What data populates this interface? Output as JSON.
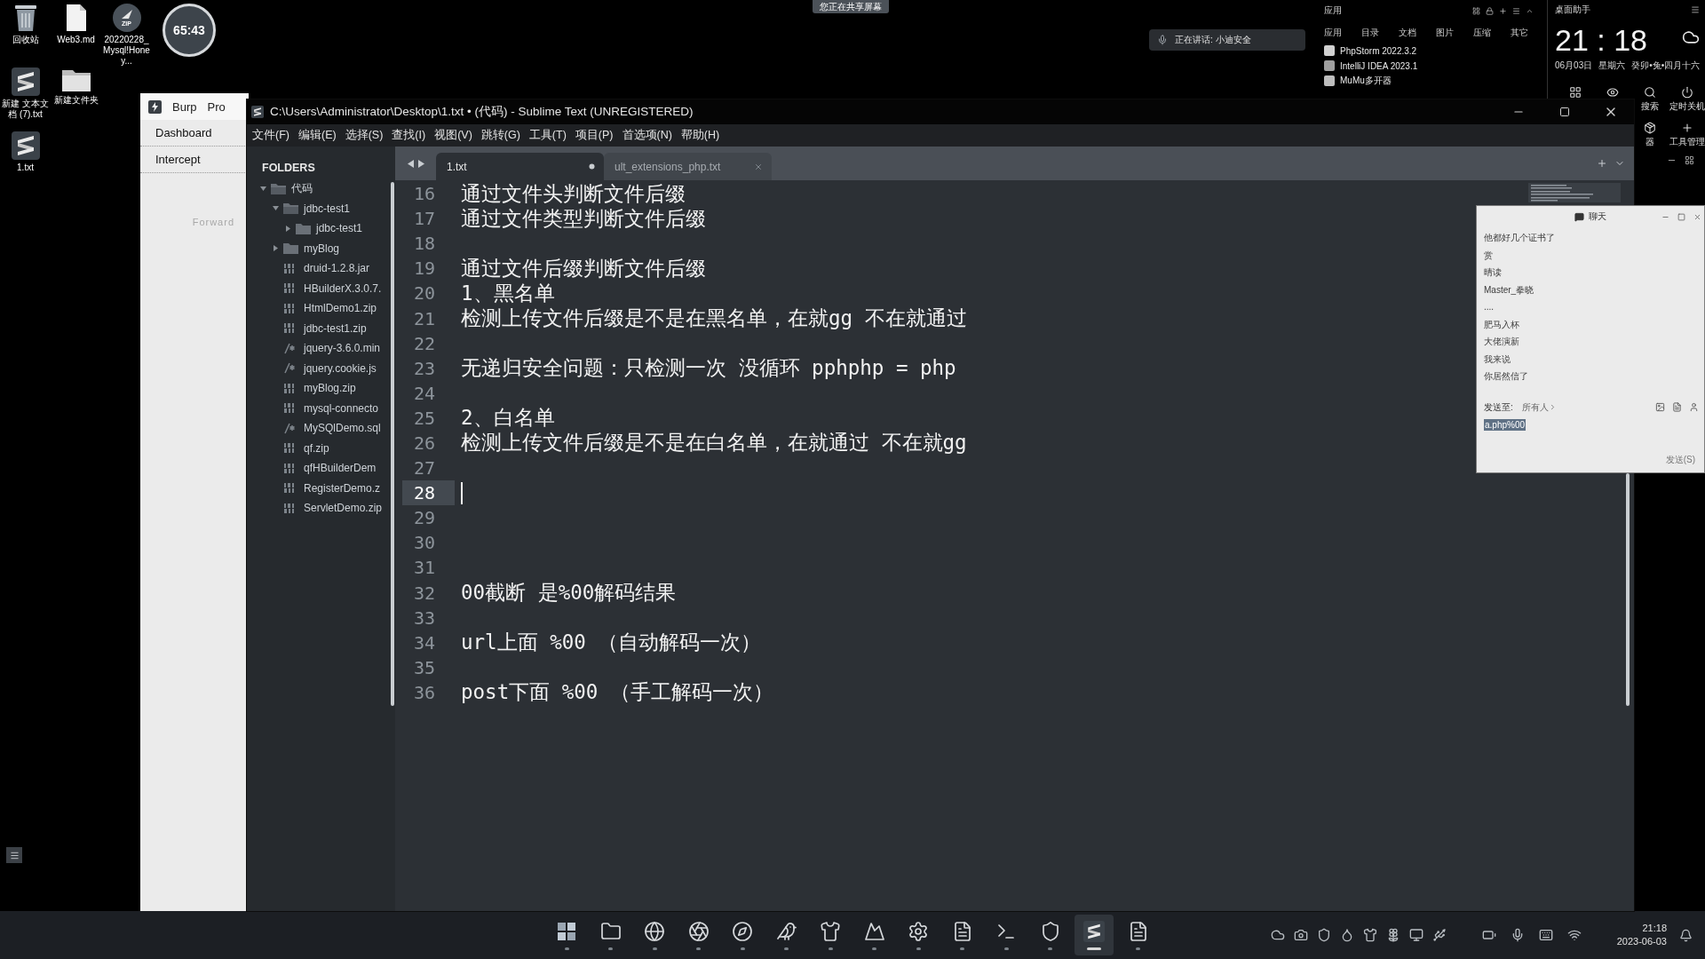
{
  "desktop": {
    "icons": [
      {
        "label": "回收站",
        "kind": "bin"
      },
      {
        "label": "Web3.md",
        "kind": "file"
      },
      {
        "label": "20220228_Mysql!Honey...",
        "kind": "zip",
        "badge": "ZIP"
      },
      {
        "label": "新建 文本文档 (7).txt",
        "kind": "sublime"
      },
      {
        "label": "新建文件夹",
        "kind": "folder"
      },
      {
        "label": "1.txt",
        "kind": "sublime"
      }
    ],
    "timer": "65:43"
  },
  "share_banner": "您正在共享屏幕",
  "voice_pill": {
    "label": "正在讲话: 小迪安全"
  },
  "apps_panel": {
    "title": "应用",
    "tabs": [
      "应用",
      "目录",
      "文档",
      "图片",
      "压缩",
      "其它"
    ],
    "items": [
      {
        "label": "PhpStorm 2022.3.2",
        "kind": "ps"
      },
      {
        "label": "IntelliJ IDEA 2023.1",
        "kind": "ij"
      },
      {
        "label": "MuMu多开器",
        "kind": "mumu"
      }
    ]
  },
  "assistant": {
    "title": "桌面助手",
    "time": "21 : 18",
    "date": "06月03日",
    "weekday": "星期六",
    "lunar": "癸卯•兔•四月十六",
    "tools_top": [
      {
        "kind": "grid"
      },
      {
        "kind": "eye"
      },
      {
        "kind": "search",
        "label": "搜索"
      },
      {
        "kind": "power",
        "label": "定时关机"
      }
    ],
    "tools_bottom": [
      {
        "kind": "box",
        "label": "器"
      },
      {
        "kind": "plus",
        "label": "工具管理"
      }
    ]
  },
  "burp": {
    "tabs": [
      "Burp",
      "Pro"
    ],
    "nav": [
      "Dashboard",
      "Intercept"
    ],
    "forward": {
      "label": "Forward",
      "disabled": true
    }
  },
  "sublime": {
    "title": "C:\\Users\\Administrator\\Desktop\\1.txt • (代码) - Sublime Text (UNREGISTERED)",
    "menu": [
      "文件(F)",
      "编辑(E)",
      "选择(S)",
      "查找(I)",
      "视图(V)",
      "跳转(G)",
      "工具(T)",
      "项目(P)",
      "首选项(N)",
      "帮助(H)"
    ],
    "sidebar": {
      "heading": "FOLDERS",
      "tree": [
        {
          "label": "代码",
          "kind": "folder",
          "expanded": true,
          "children": [
            {
              "label": "jdbc-test1",
              "kind": "folder",
              "expanded": true,
              "children": [
                {
                  "label": "jdbc-test1",
                  "kind": "folder",
                  "expanded": false
                }
              ]
            },
            {
              "label": "myBlog",
              "kind": "folder",
              "expanded": false
            },
            {
              "label": "druid-1.2.8.jar",
              "kind": "binary"
            },
            {
              "label": "HBuilderX.3.0.7.",
              "kind": "binary"
            },
            {
              "label": "HtmlDemo1.zip",
              "kind": "binary"
            },
            {
              "label": "jdbc-test1.zip",
              "kind": "binary"
            },
            {
              "label": "jquery-3.6.0.min",
              "kind": "script"
            },
            {
              "label": "jquery.cookie.js",
              "kind": "script"
            },
            {
              "label": "myBlog.zip",
              "kind": "binary"
            },
            {
              "label": "mysql-connecto",
              "kind": "binary"
            },
            {
              "label": "MySQlDemo.sql",
              "kind": "script"
            },
            {
              "label": "qf.zip",
              "kind": "binary"
            },
            {
              "label": "qfHBuilderDem",
              "kind": "binary"
            },
            {
              "label": "RegisterDemo.z",
              "kind": "binary"
            },
            {
              "label": "ServletDemo.zip",
              "kind": "binary"
            }
          ]
        }
      ]
    },
    "tabs": [
      {
        "label": "1.txt",
        "selected": true,
        "dirty": true
      },
      {
        "label": "ult_extensions_php.txt",
        "selected": false,
        "dirty": false
      }
    ],
    "lines": [
      {
        "number": "16",
        "text": "通过文件头判断文件后缀",
        "current": false
      },
      {
        "number": "17",
        "text": "通过文件类型判断文件后缀",
        "current": false
      },
      {
        "number": "18",
        "current": false
      },
      {
        "number": "19",
        "text": "通过文件后缀判断文件后缀",
        "current": false
      },
      {
        "number": "20",
        "text": "1、黑名单",
        "current": false
      },
      {
        "number": "21",
        "text": "检测上传文件后缀是不是在黑名单，在就gg 不在就通过",
        "current": false
      },
      {
        "number": "22",
        "current": false
      },
      {
        "number": "23",
        "text": "无递归安全问题：只检测一次 没循环 pphphp = php",
        "current": false
      },
      {
        "number": "24",
        "current": false
      },
      {
        "number": "25",
        "text": "2、白名单",
        "current": false
      },
      {
        "number": "26",
        "text": "检测上传文件后缀是不是在白名单，在就通过 不在就gg",
        "current": false
      },
      {
        "number": "27",
        "current": false
      },
      {
        "number": "28",
        "current": true
      },
      {
        "number": "29",
        "current": false
      },
      {
        "number": "30",
        "current": false
      },
      {
        "number": "31",
        "current": false
      },
      {
        "number": "32",
        "text": "00截断 是%00解码结果",
        "current": false
      },
      {
        "number": "33",
        "current": false
      },
      {
        "number": "34",
        "text": "url上面 %00 （自动解码一次）",
        "current": false
      },
      {
        "number": "35",
        "current": false
      },
      {
        "number": "36",
        "text": "post下面 %00 （手工解码一次）",
        "current": false
      }
    ]
  },
  "chat": {
    "title": "聊天",
    "messages": [
      "他都好几个证书了",
      "赏",
      "晴读",
      "Master_拳晓",
      "....",
      "肥马入杯",
      "大佬演新",
      "我来说",
      "你居然信了"
    ],
    "send_to": {
      "label": "发送至:",
      "value": "所有人"
    },
    "input": {
      "value": "a.php%00",
      "highlighted": true
    },
    "send_button": "发送(S)"
  },
  "taskbar": {
    "apps": [
      {
        "kind": "grid",
        "active": false
      },
      {
        "kind": "folder",
        "active": false
      },
      {
        "kind": "globe",
        "active": false
      },
      {
        "kind": "aperture",
        "active": false
      },
      {
        "kind": "compass",
        "active": false
      },
      {
        "kind": "bird",
        "active": false
      },
      {
        "kind": "shirt",
        "active": false
      },
      {
        "kind": "mountain",
        "active": false
      },
      {
        "kind": "gear",
        "active": false
      },
      {
        "kind": "document",
        "active": false
      },
      {
        "kind": "terminal",
        "active": false
      },
      {
        "kind": "shield",
        "active": false
      },
      {
        "kind": "stripes",
        "active": true
      },
      {
        "kind": "document",
        "active": false
      }
    ],
    "time": "21:18",
    "date": "2023-06-03"
  }
}
